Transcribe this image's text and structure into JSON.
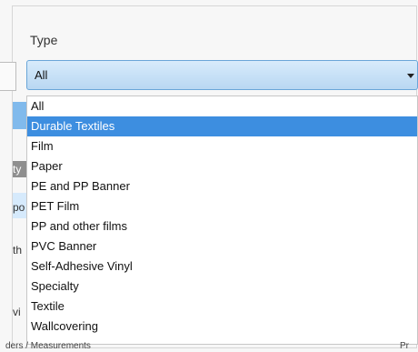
{
  "field": {
    "label": "Type",
    "selected_value": "All"
  },
  "dropdown": {
    "options": [
      "All",
      "Durable Textiles",
      "Film",
      "Paper",
      "PE and PP Banner",
      "PET Film",
      "PP and other films",
      "PVC Banner",
      "Self-Adhesive Vinyl",
      "Specialty",
      "Textile",
      "Wallcovering"
    ],
    "highlighted_index": 1,
    "highlight_color": "#3d8ee0"
  },
  "background_fragments": {
    "frag1": "ty",
    "frag2": "po",
    "frag3": "th",
    "frag4": "vi",
    "bottom_left": "ders / Measurements",
    "bottom_right": "Pr"
  },
  "colors": {
    "select_border": "#6aa6d8",
    "select_gradient_top": "#d8ebfb",
    "select_gradient_bottom": "#b9d7f2"
  }
}
